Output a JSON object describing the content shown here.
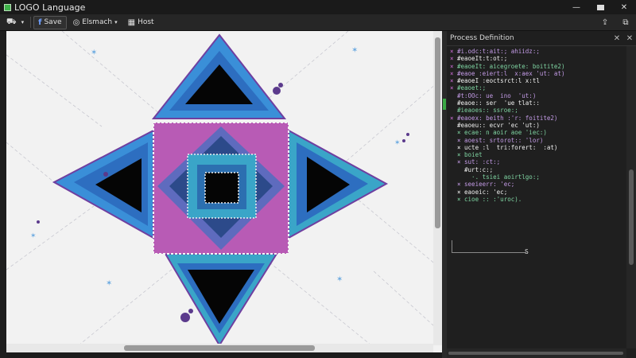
{
  "window": {
    "title": "LOGO Language"
  },
  "toolbar": {
    "save_label": "Save",
    "menu2_label": "Elsmach",
    "menu3_label": "Host"
  },
  "panel": {
    "title": "Process Definition",
    "code_lines": [
      {
        "mark": "×",
        "text": "#i.odc:t:ait:; ahiidz:;"
      },
      {
        "mark": "×",
        "text": "#eaoeIt:t:ot:;"
      },
      {
        "mark": "×",
        "text": "#eaoeIt: aicegroete: boitite2)"
      },
      {
        "mark": "×",
        "text": "#eaoe :eiert:l  x:aex 'ut: at)"
      },
      {
        "mark": "×",
        "text": "#eaoeI :eoctsrct:l x:tl"
      },
      {
        "mark": "×",
        "text": "#eaoet:;"
      },
      {
        "mark": " ",
        "text": "#t:OOc: ue  ino  'ut:)"
      },
      {
        "mark": " ",
        "text": "#eaoe:: ser  'ue tlat::"
      },
      {
        "mark": " ",
        "text": "#ieaoes:: ssroe:;"
      },
      {
        "mark": "×",
        "text": "#eaoex: beith :'r: foitite2)"
      },
      {
        "mark": " ",
        "text": "#eaoeu:: ecvr 'ec 'ut:)"
      },
      {
        "mark": " ",
        "text": "× ecae: n aoir aoe 'iec:)"
      },
      {
        "mark": " ",
        "text": "× aoest: srtorot:: 'lor)"
      },
      {
        "mark": " ",
        "text": "× ucte :l  tri:forert:  :at)"
      },
      {
        "mark": " ",
        "text": "× boiet"
      },
      {
        "mark": " ",
        "text": "× sut: :ct:;"
      },
      {
        "mark": " ",
        "text": "  #urt:c:;"
      },
      {
        "mark": " ",
        "text": "    ·. tsiei aoirtlgo:;"
      },
      {
        "mark": " ",
        "text": "× seeieerr: 'ec;"
      },
      {
        "mark": " ",
        "text": "× eaoeic: 'ec;"
      },
      {
        "mark": " ",
        "text": "× cioe :: :'uroc)."
      }
    ],
    "end_label": "S"
  },
  "colors": {
    "blue": "#3b7fd0",
    "teal": "#3aa5c8",
    "magenta": "#b85bb5",
    "dark_blue": "#2c4a8a",
    "black": "#050505"
  }
}
